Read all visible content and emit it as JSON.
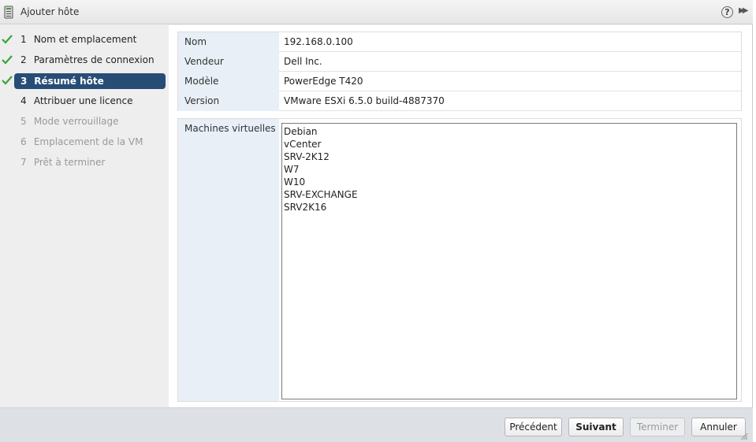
{
  "window": {
    "title": "Ajouter hôte"
  },
  "steps": [
    {
      "num": "1",
      "label": "Nom et emplacement",
      "state": "done"
    },
    {
      "num": "2",
      "label": "Paramètres de connexion",
      "state": "done"
    },
    {
      "num": "3",
      "label": "Résumé hôte",
      "state": "active"
    },
    {
      "num": "4",
      "label": "Attribuer une licence",
      "state": "next"
    },
    {
      "num": "5",
      "label": "Mode verrouillage",
      "state": "disabled"
    },
    {
      "num": "6",
      "label": "Emplacement de la VM",
      "state": "disabled"
    },
    {
      "num": "7",
      "label": "Prêt à terminer",
      "state": "disabled"
    }
  ],
  "summary": {
    "rows": [
      {
        "label": "Nom",
        "value": "192.168.0.100"
      },
      {
        "label": "Vendeur",
        "value": "Dell Inc."
      },
      {
        "label": "Modèle",
        "value": "PowerEdge T420"
      },
      {
        "label": "Version",
        "value": "VMware ESXi 6.5.0 build-4887370"
      }
    ],
    "vm_label": "Machines virtuelles",
    "vms": [
      "Debian",
      "vCenter",
      "SRV-2K12",
      "W7",
      "W10",
      "SRV-EXCHANGE",
      "SRV2K16"
    ]
  },
  "footer": {
    "back_label": "Précédent",
    "next_label": "Suivant",
    "finish_label": "Terminer",
    "cancel_label": "Annuler"
  },
  "icons": {
    "check": "check-icon",
    "help": "help-icon",
    "expand": "expand-icon",
    "host": "host-icon"
  },
  "colors": {
    "active_step": "#274d77",
    "check_green": "#3aa53a",
    "label_bg": "#e8eff6"
  }
}
